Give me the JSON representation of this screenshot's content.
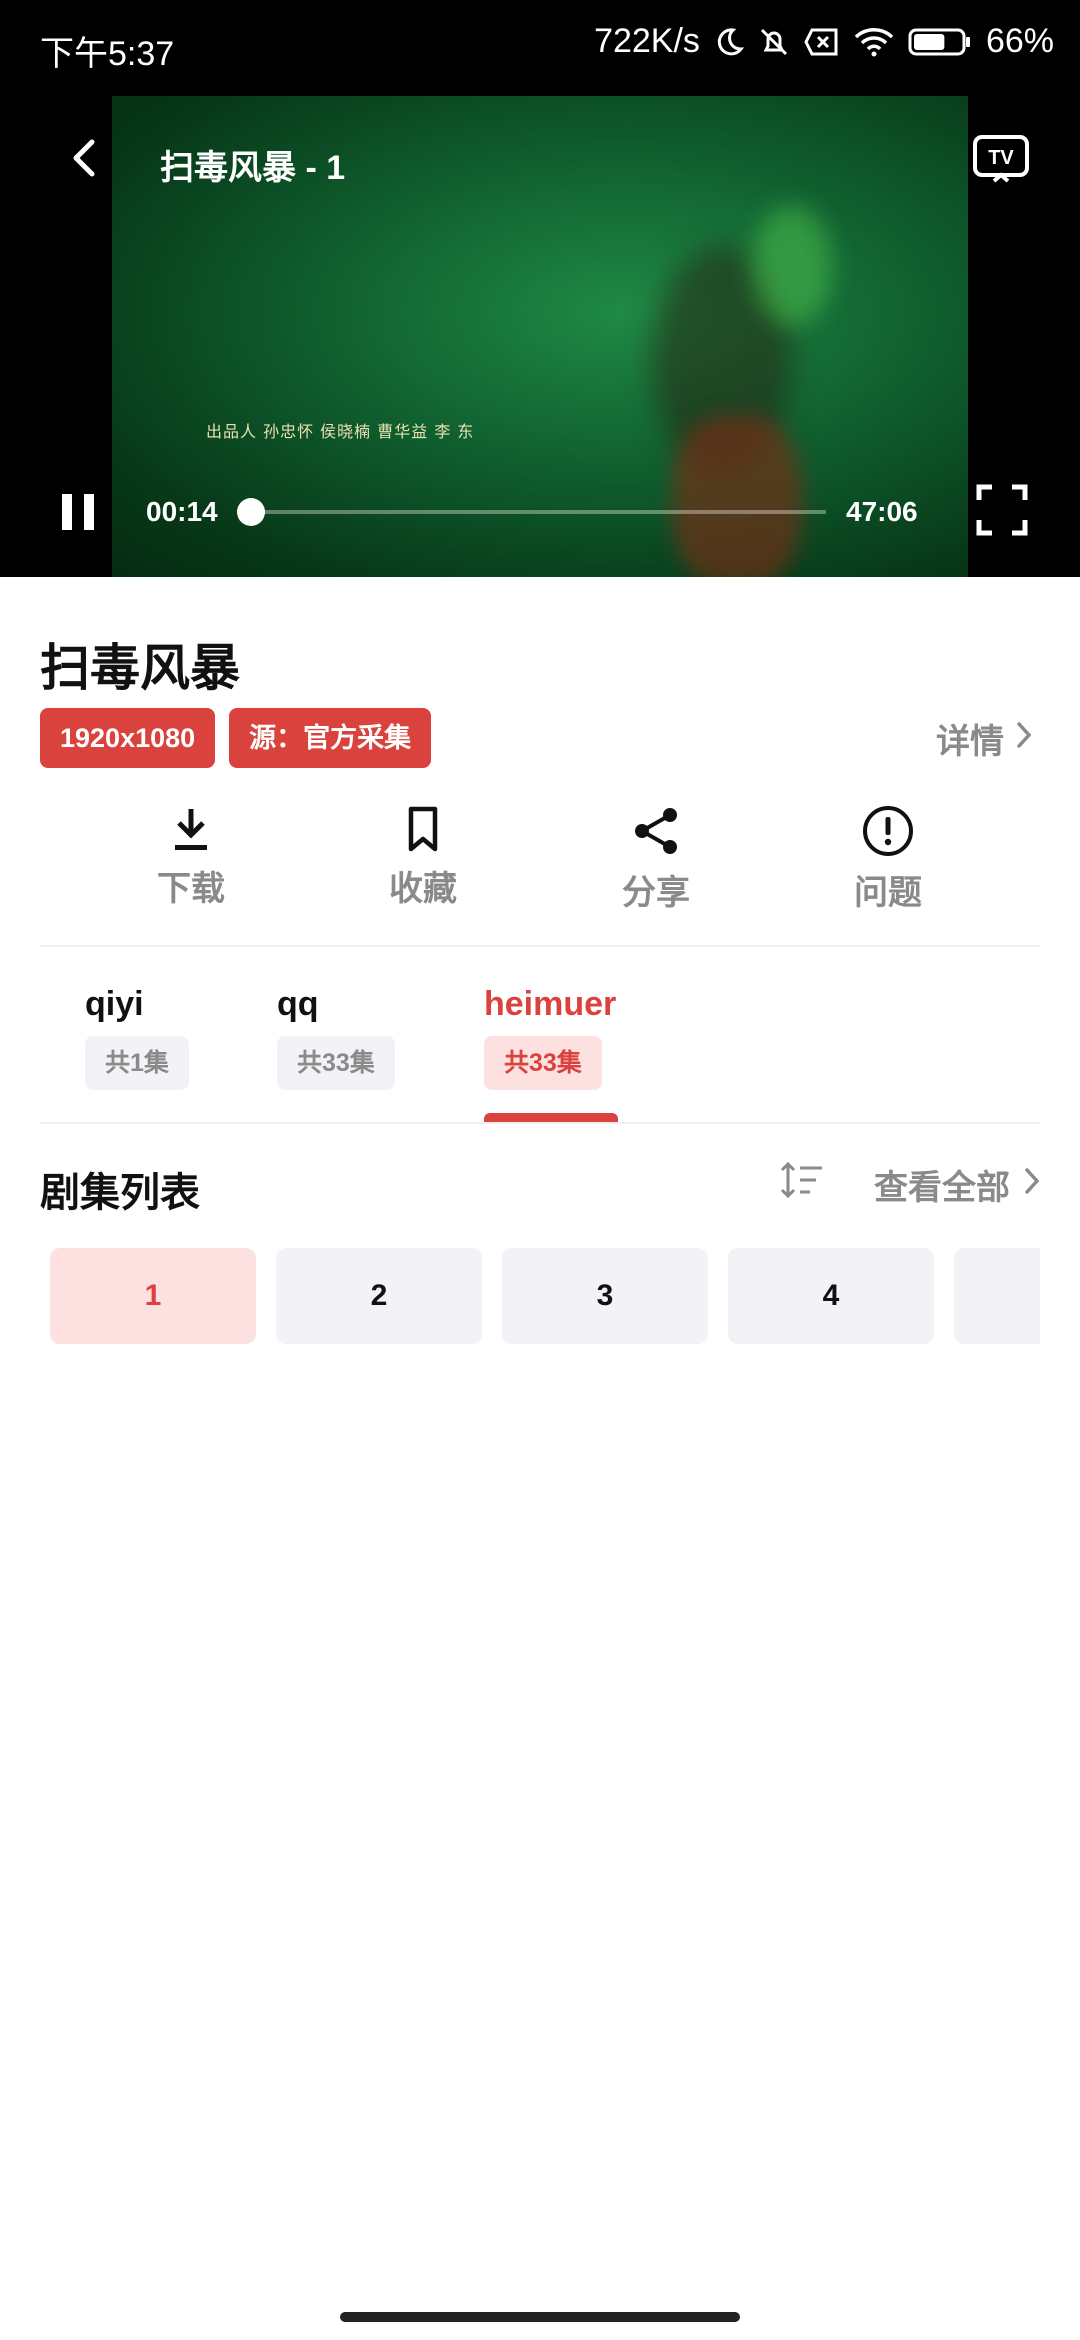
{
  "status_bar": {
    "time": "下午5:37",
    "net_speed": "722K/s",
    "battery": "66%",
    "battery_level": 0.66,
    "icons": [
      "moon-icon",
      "bell-off-icon",
      "sim-x-icon",
      "wifi-icon",
      "battery-icon"
    ]
  },
  "player": {
    "title": "扫毒风暴 - 1",
    "credits": "出品人   孙忠怀  侯晓楠  曹华益  李  东",
    "current_time": "00:14",
    "total_time": "47:06",
    "progress": 0.005,
    "icons": {
      "back": "back-icon",
      "cast": "tv-cast-icon",
      "pause": "pause-icon",
      "fullscreen": "fullscreen-icon"
    }
  },
  "info": {
    "title": "扫毒风暴",
    "badges": [
      "1920x1080",
      "源：官方采集"
    ],
    "details_label": "详情"
  },
  "actions": [
    {
      "label": "下载",
      "icon": "download-icon"
    },
    {
      "label": "收藏",
      "icon": "bookmark-icon"
    },
    {
      "label": "分享",
      "icon": "share-icon"
    },
    {
      "label": "问题",
      "icon": "alert-icon"
    }
  ],
  "sources": [
    {
      "name": "qiyi",
      "count": "共1集",
      "active": false
    },
    {
      "name": "qq",
      "count": "共33集",
      "active": false
    },
    {
      "name": "heimuer",
      "count": "共33集",
      "active": true
    }
  ],
  "episodes": {
    "heading": "剧集列表",
    "view_all": "查看全部",
    "items": [
      "1",
      "2",
      "3",
      "4",
      ""
    ],
    "active_index": 0
  },
  "colors": {
    "accent": "#d9423d",
    "accent_light": "#fde1e1",
    "chip_bg": "#f3f3f7",
    "muted": "#8a8a8a"
  }
}
